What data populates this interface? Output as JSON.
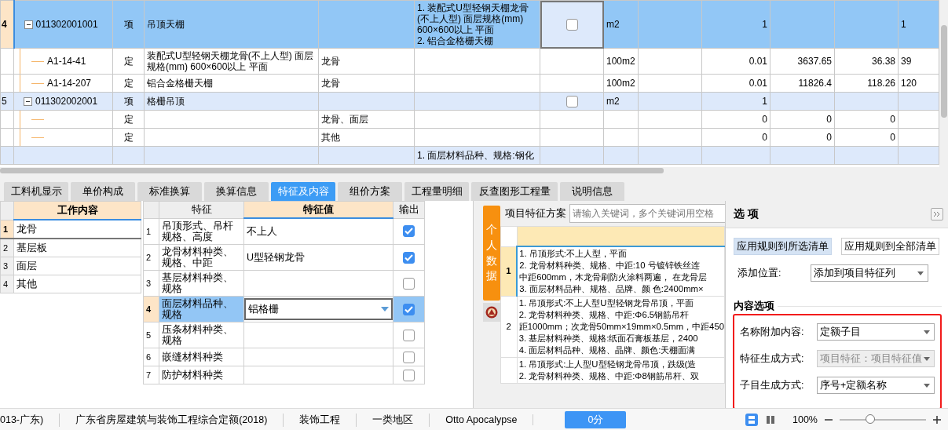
{
  "grid": {
    "rows": [
      {
        "kind": "item",
        "num": "4",
        "code": "011302001001",
        "expanded": true,
        "type": "项",
        "name": "吊顶天棚",
        "feature": "1. 装配式U型轻钢天棚龙骨(不上人型) 面层规格(mm) 600×600以上 平面\n2. 铝合金格栅天棚",
        "checked": false,
        "unit": "m2",
        "qty": "1",
        "col_last": "1",
        "selected": true
      },
      {
        "kind": "sub",
        "code": "A1-14-41",
        "type": "定",
        "name": "装配式U型轻钢天棚龙骨(不上人型) 面层规格(mm) 600×600以上 平面",
        "col_4": "龙骨",
        "unit": "100m2",
        "qty": "0.01",
        "price": "3637.65",
        "total": "36.38",
        "col_last": "39",
        "selected": false
      },
      {
        "kind": "sub",
        "code": "A1-14-207",
        "type": "定",
        "name": "铝合金格栅天棚",
        "col_4": "龙骨",
        "unit": "100m2",
        "qty": "0.01",
        "price": "11826.4",
        "total": "118.26",
        "col_last": "120",
        "selected": false
      },
      {
        "kind": "item",
        "num": "5",
        "code": "011302002001",
        "expanded": true,
        "type": "项",
        "name": "格栅吊顶",
        "checked": false,
        "unit": "m2",
        "qty": "1",
        "selected": false
      },
      {
        "kind": "sub",
        "type": "定",
        "col_4": "龙骨、面层",
        "qty": "0",
        "price": "0",
        "total": "0",
        "selected": false
      },
      {
        "kind": "sub",
        "type": "定",
        "col_4": "其他",
        "qty": "0",
        "price": "0",
        "total": "0",
        "selected": false
      },
      {
        "kind": "item",
        "feature": "1. 面层材料品种、规格:钢化",
        "selected": false
      }
    ]
  },
  "tabs": [
    {
      "label": "工料机显示",
      "selected": false
    },
    {
      "label": "单价构成",
      "selected": false
    },
    {
      "label": "标准换算",
      "selected": false
    },
    {
      "label": "换算信息",
      "selected": false
    },
    {
      "label": "特征及内容",
      "selected": true
    },
    {
      "label": "组价方案",
      "selected": false
    },
    {
      "label": "工程量明细",
      "selected": false
    },
    {
      "label": "反查图形工程量",
      "selected": false
    },
    {
      "label": "说明信息",
      "selected": false
    }
  ],
  "work_content": {
    "header": "工作内容",
    "rows": [
      {
        "num": "1",
        "text": "龙骨",
        "selected": true
      },
      {
        "num": "2",
        "text": "基层板",
        "selected": false
      },
      {
        "num": "3",
        "text": "面层",
        "selected": false
      },
      {
        "num": "4",
        "text": "其他",
        "selected": false
      }
    ]
  },
  "features": {
    "columns": [
      "特征",
      "特征值",
      "输出"
    ],
    "rows": [
      {
        "num": "1",
        "name": "吊顶形式、吊杆规格、高度",
        "value": "不上人",
        "output": true,
        "selected": false
      },
      {
        "num": "2",
        "name": "龙骨材料种类、规格、中距",
        "value": "U型轻钢龙骨",
        "output": true,
        "selected": false
      },
      {
        "num": "3",
        "name": "基层材料种类、规格",
        "output": false,
        "selected": false
      },
      {
        "num": "4",
        "name": "面层材料品种、规格",
        "value": "铝格栅",
        "output": true,
        "selected": true
      },
      {
        "num": "5",
        "name": "压条材料种类、规格",
        "output": false,
        "selected": false
      },
      {
        "num": "6",
        "name": "嵌缝材料种类",
        "output": false,
        "selected": false
      },
      {
        "num": "7",
        "name": "防护材料种类",
        "output": false,
        "selected": false
      }
    ]
  },
  "scheme": {
    "side_tab": "个人数据",
    "label": "项目特征方案",
    "placeholder": "请输入关键词，多个关键词用空格",
    "rows": [
      {
        "num": "1",
        "selected": true,
        "lines": [
          "1. 吊顶形式:不上人型，平面",
          "2. 龙骨材料种类、规格、中距:10 号镀锌铁丝连",
          "中距600mm，木龙骨刷防火涂料两遍， 在龙骨层",
          "3. 面层材料品种、规格、品牌、颜 色:2400mm×"
        ]
      },
      {
        "num": "2",
        "selected": false,
        "lines": [
          "1. 吊顶形式:不上人型U型轻钢龙骨吊顶，平面",
          "2. 龙骨材料种类、规格、中距:Φ6.5钢筋吊杆",
          "距1000mm；次龙骨50mm×19mm×0.5mm，中距450",
          "3. 基层材料种类、规格:纸面石膏板基层，2400",
          "4. 面层材料品种、规格、晶牌、颜色:天棚面满"
        ]
      },
      {
        "selected": false,
        "lines": [
          "1. 吊顶形式:上人型U型轻钢龙骨吊顶，跌级(造",
          "2. 龙骨材料种类、规格、中距:Φ8钢筋吊杆、双"
        ]
      }
    ]
  },
  "options": {
    "title": "选 项",
    "buttons": [
      {
        "label": "应用规则到所选清单",
        "selected": true
      },
      {
        "label": "应用规则到全部清单",
        "selected": false
      }
    ],
    "position": {
      "label": "添加位置:",
      "value": "添加到项目特征列"
    },
    "section": "内容选项",
    "fields": [
      {
        "label": "名称附加内容:",
        "value": "定额子目",
        "disabled": false
      },
      {
        "label": "特征生成方式:",
        "value": "项目特征：项目特征值",
        "disabled": true
      },
      {
        "label": "子目生成方式:",
        "value": "序号+定额名称",
        "disabled": false
      }
    ]
  },
  "status": {
    "items": [
      "013-广东)",
      "广东省房屋建筑与装饰工程综合定额(2018)",
      "装饰工程",
      "一类地区",
      "Otto Apocalypse"
    ],
    "score": "0分",
    "views": [
      {
        "selected": true
      },
      {
        "selected": false
      }
    ],
    "zoom": "100%",
    "zoom_slider": {
      "level": 0.35
    }
  }
}
